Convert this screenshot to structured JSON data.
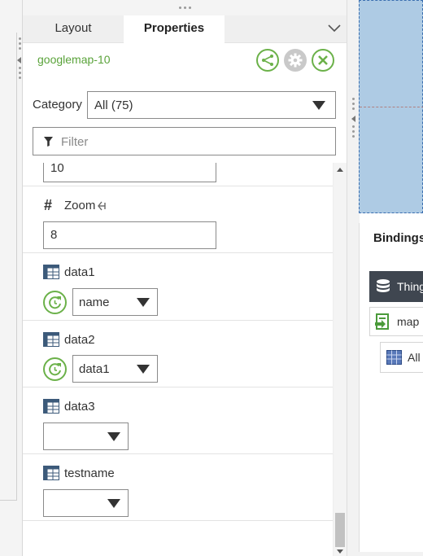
{
  "tabs": {
    "layout": "Layout",
    "properties": "Properties"
  },
  "widget": {
    "name": "googlemap-10"
  },
  "category": {
    "label": "Category",
    "value": "All (75)"
  },
  "filter": {
    "placeholder": "Filter"
  },
  "properties": {
    "top_input_value": "10",
    "zoom": {
      "label": "Zoom",
      "value": "8"
    },
    "data1": {
      "label": "data1",
      "value": "name"
    },
    "data2": {
      "label": "data2",
      "value": "data1"
    },
    "data3": {
      "label": "data3",
      "value": ""
    },
    "testname": {
      "label": "testname",
      "value": ""
    }
  },
  "bindings": {
    "title": "Bindings",
    "things_label": "Thing",
    "map_label": "map",
    "all_label": "All"
  },
  "colors": {
    "accent_green": "#5aa33a",
    "map_blue": "#aecbe4",
    "dark_bar": "#3f4650"
  }
}
